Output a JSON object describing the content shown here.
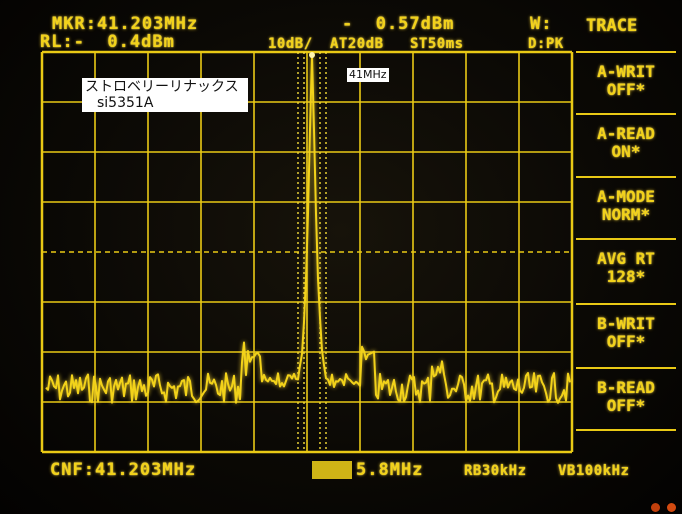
{
  "header": {
    "marker_freq": "MKR:41.203MHz",
    "marker_level": "-  0.57dBm",
    "mode_w": "W:",
    "ref_level": "RL:-  0.4dBm",
    "scale": "10dB/",
    "attenuation": "AT20dB",
    "sweep": "ST50ms",
    "detector": "D:PK"
  },
  "panel": {
    "title": "TRACE",
    "softkeys": [
      {
        "line1": "A-WRIT",
        "line2": "OFF*"
      },
      {
        "line1": "A-READ",
        "line2": "ON*"
      },
      {
        "line1": "A-MODE",
        "line2": "NORM*"
      },
      {
        "line1": "AVG RT",
        "line2": "128*"
      },
      {
        "line1": "B-WRIT",
        "line2": "OFF*"
      },
      {
        "line1": "B-READ",
        "line2": "OFF*"
      }
    ]
  },
  "footer": {
    "center_freq": "CNF:41.203MHz",
    "span": "5.8MHz",
    "rbw": "RB30kHz",
    "vbw": "VB100kHz"
  },
  "annotations": {
    "title_line1": "ストロベリーリナックス",
    "title_line2": "si5351A",
    "peak_label": "41MHz"
  },
  "colors": {
    "trace": "#f2d21a",
    "grid": "#e9c915",
    "background": "#0b0905"
  }
}
